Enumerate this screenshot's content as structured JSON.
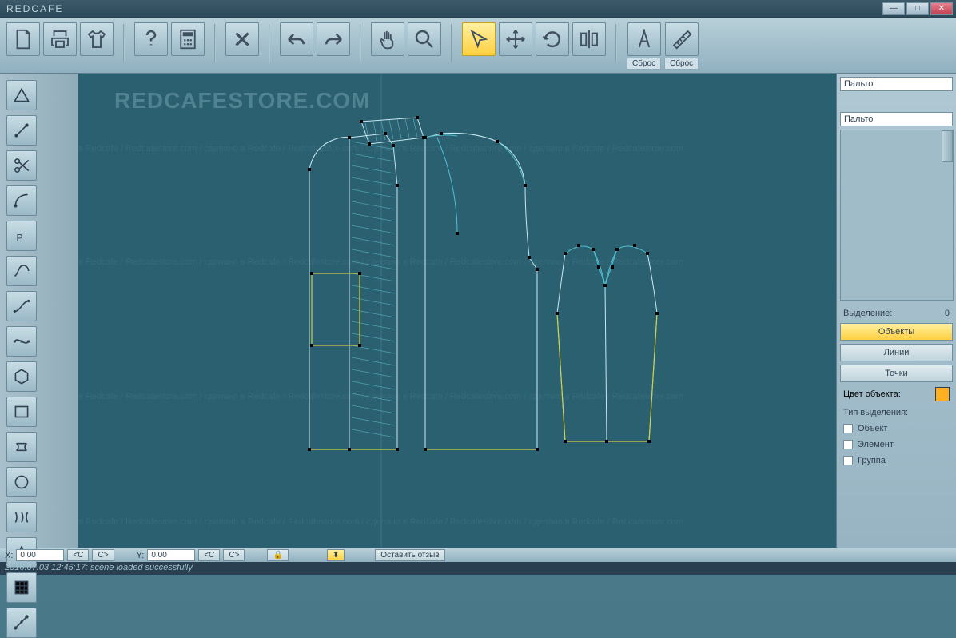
{
  "window": {
    "title": "REDCAFE"
  },
  "toolbar": {
    "reset_label": "Сброс"
  },
  "right_panel": {
    "object_name1": "Пальто",
    "object_name2": "Пальто",
    "selection_label": "Выделение:",
    "selection_count": "0",
    "objects_btn": "Объекты",
    "lines_btn": "Линии",
    "points_btn": "Точки",
    "color_label": "Цвет объекта:",
    "selection_type_label": "Тип выделения:",
    "check_object": "Объект",
    "check_element": "Элемент",
    "check_group": "Группа"
  },
  "status": {
    "x_label": "X:",
    "x_value": "0.00",
    "y_label": "Y:",
    "y_value": "0.00",
    "c_left": "<C",
    "c_right": "C>",
    "feedback": "Оставить отзыв"
  },
  "footer": {
    "log": "2016.07.03 12:45:17: scene loaded successfully"
  },
  "watermark": {
    "big": "REDCAFESTORE.COM",
    "line": "в Redcafe / Redcafestore.com / сделано в Redcafe / Redcafestore.com / сделано в Redcafe / Redcafestore.com / сделано в Redcafe / Redcafestore.com"
  }
}
